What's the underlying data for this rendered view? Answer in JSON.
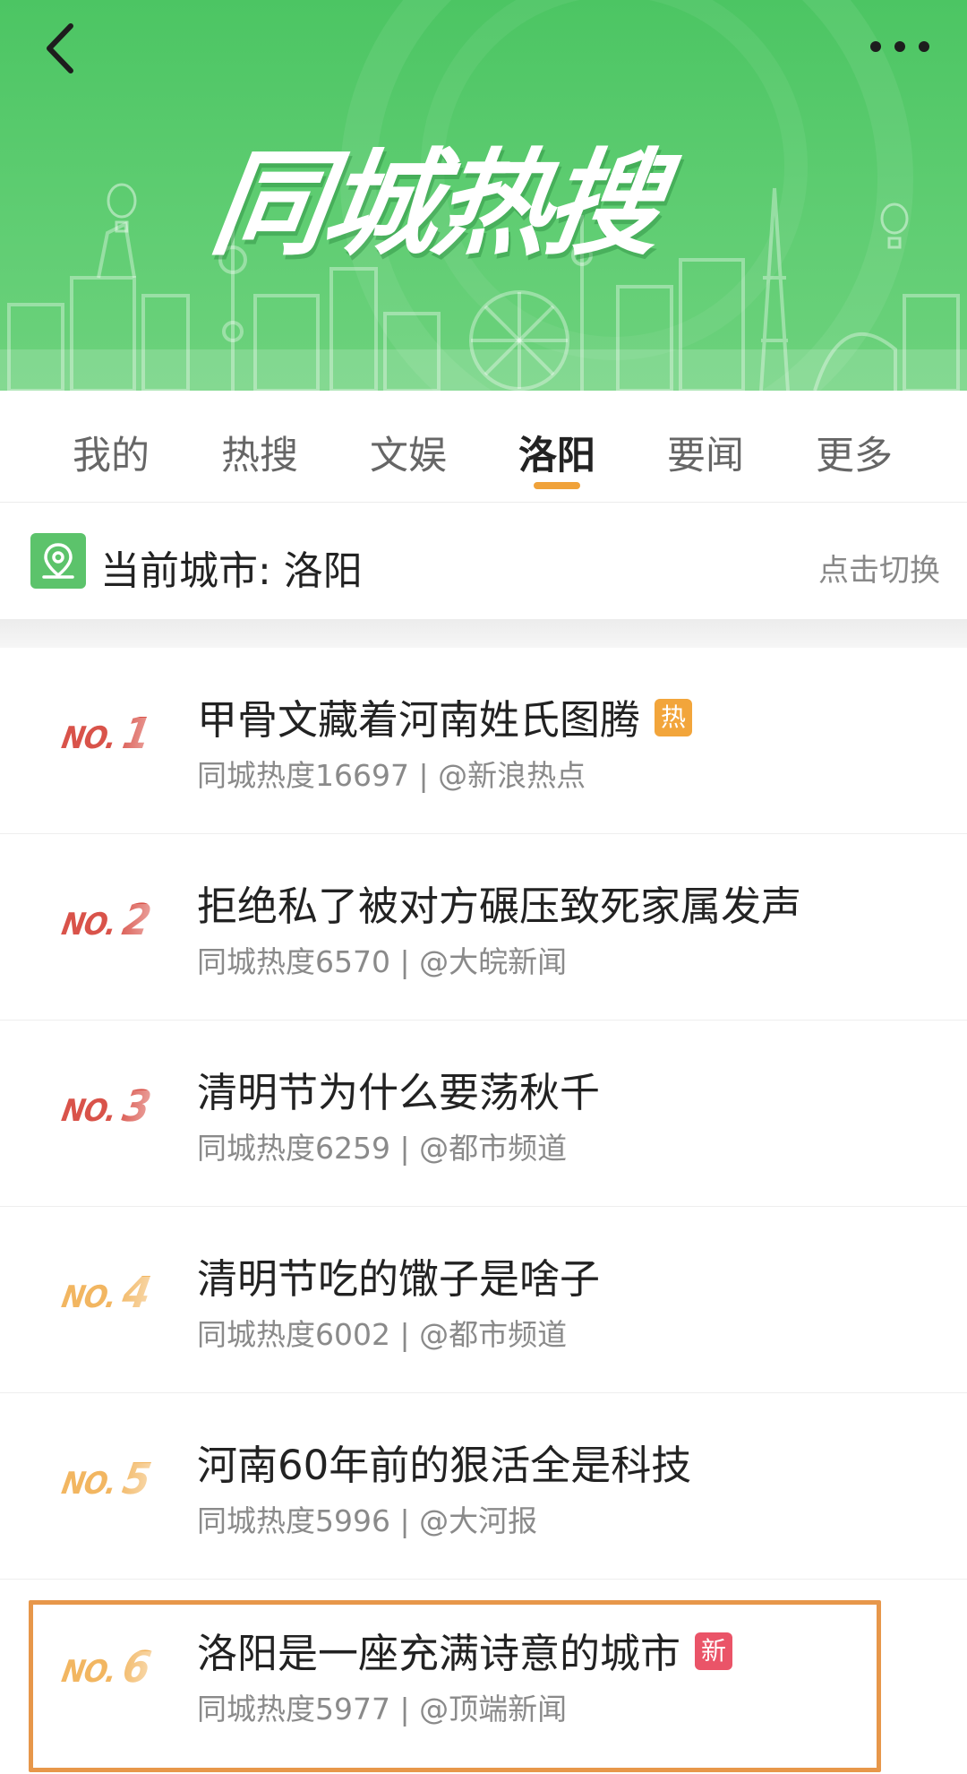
{
  "header": {
    "title": "同城热搜",
    "back_icon": "chevron-left-icon",
    "more_icon": "more-dots-icon",
    "background_color": "#5cc96d"
  },
  "tabs": [
    {
      "label": "我的",
      "active": false
    },
    {
      "label": "热搜",
      "active": false
    },
    {
      "label": "文娱",
      "active": false
    },
    {
      "label": "洛阳",
      "active": true
    },
    {
      "label": "要闻",
      "active": false
    },
    {
      "label": "更多",
      "active": false
    }
  ],
  "city": {
    "label": "当前城市: 洛阳",
    "switch_label": "点击切换",
    "icon": "location-pin-icon"
  },
  "list": [
    {
      "rank": "1",
      "title": "甲骨文藏着河南姓氏图腾",
      "meta": "同城热度16697 | @新浪热点",
      "badge": "热"
    },
    {
      "rank": "2",
      "title": "拒绝私了被对方碾压致死家属发声",
      "meta": "同城热度6570 | @大皖新闻",
      "badge": ""
    },
    {
      "rank": "3",
      "title": "清明节为什么要荡秋千",
      "meta": "同城热度6259 | @都市频道",
      "badge": ""
    },
    {
      "rank": "4",
      "title": "清明节吃的馓子是啥子",
      "meta": "同城热度6002 | @都市频道",
      "badge": ""
    },
    {
      "rank": "5",
      "title": "河南60年前的狠活全是科技",
      "meta": "同城热度5996 | @大河报",
      "badge": ""
    },
    {
      "rank": "6",
      "title": "洛阳是一座充满诗意的城市",
      "meta": "同城热度5977 | @顶端新闻",
      "badge": "新"
    }
  ],
  "rank_prefix": "NO.",
  "colors": {
    "accent_tab": "#f0a23a",
    "rank_top": "#d9534a",
    "rank_rest": "#f2b661",
    "badge_hot": "#f2a53b",
    "badge_new": "#ea5468",
    "highlight_border": "#e7974a"
  }
}
